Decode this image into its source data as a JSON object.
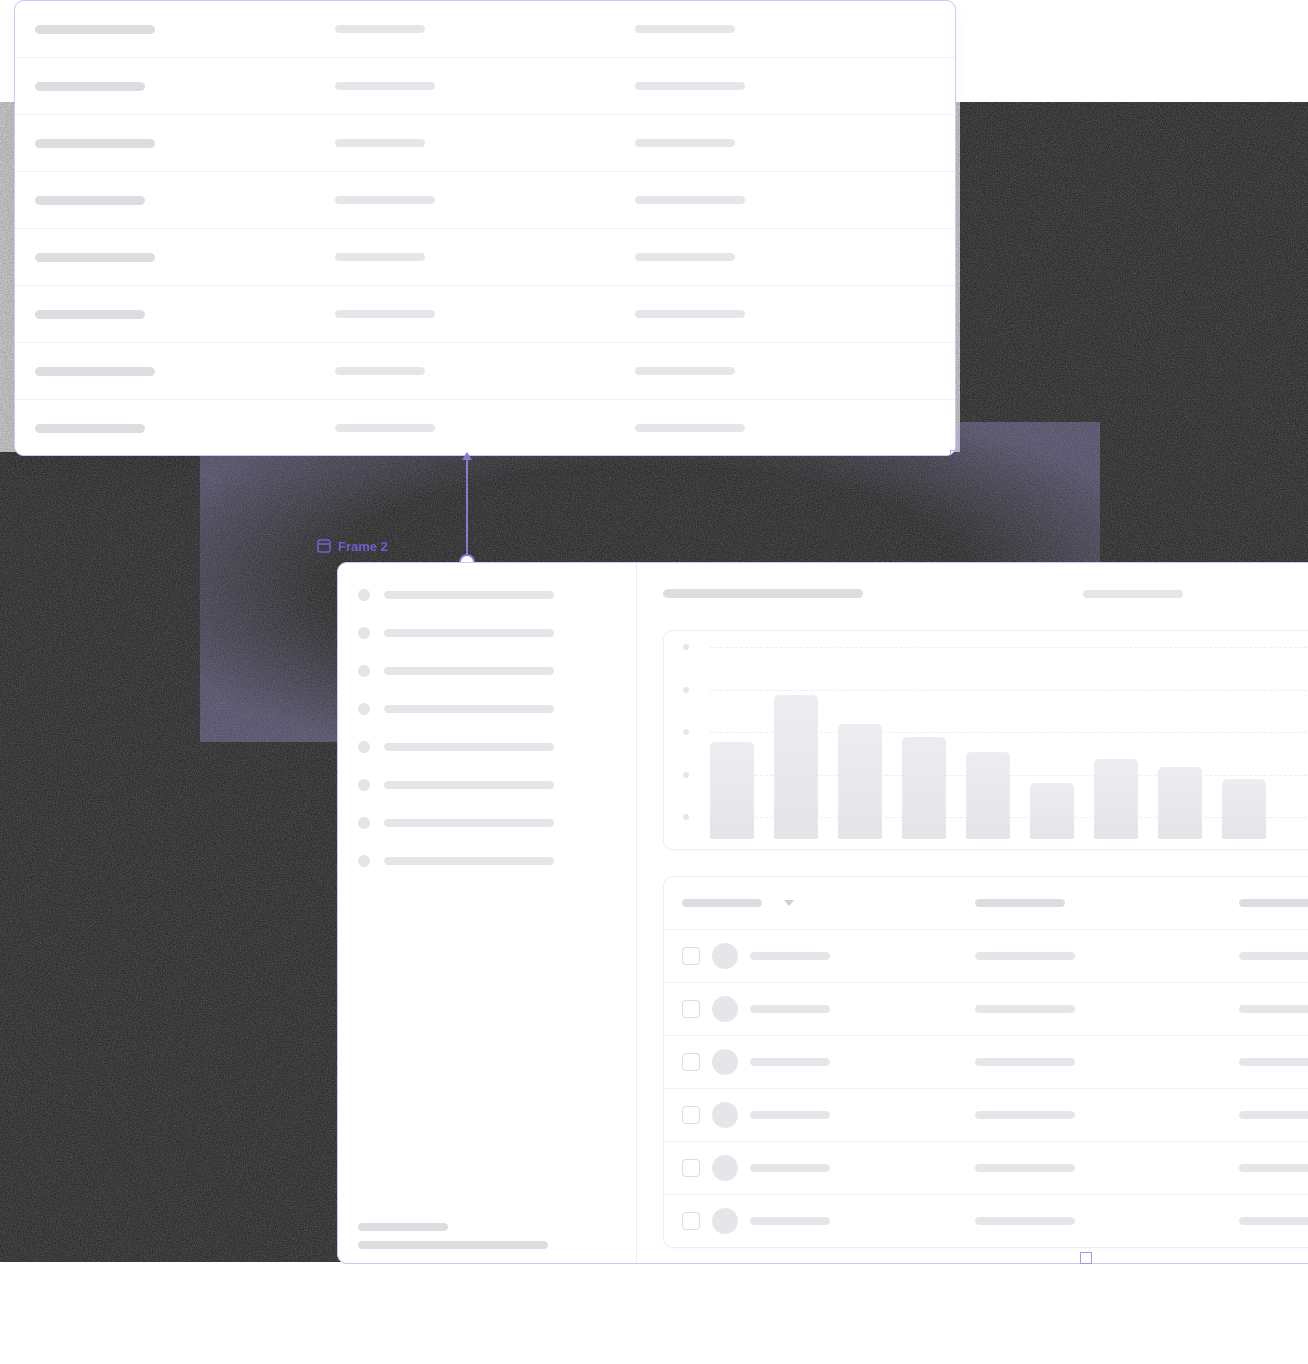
{
  "designer": {
    "selected_frame_label": "Frame 2"
  },
  "frame1": {
    "rows": 8,
    "cols": 3
  },
  "frame2": {
    "sidebar": {
      "items": 8
    },
    "list": {
      "rows": 6
    }
  },
  "chart_data": {
    "type": "bar",
    "title": "",
    "xlabel": "",
    "ylabel": "",
    "ylim": [
      0,
      120
    ],
    "y_ticks": [
      0,
      30,
      60,
      90,
      120
    ],
    "categories": [
      "",
      "",
      "",
      "",
      "",
      "",
      "",
      "",
      ""
    ],
    "values": [
      78,
      115,
      92,
      82,
      70,
      45,
      64,
      58,
      48
    ]
  }
}
